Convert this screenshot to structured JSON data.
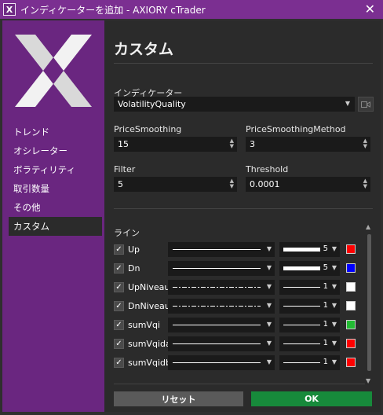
{
  "window": {
    "title": "インディケーターを追加 - AXIORY cTrader",
    "icon_glyph": "X",
    "close_glyph": "✕"
  },
  "sidebar": {
    "items": [
      {
        "label": "トレンド",
        "active": false
      },
      {
        "label": "オシレーター",
        "active": false
      },
      {
        "label": "ボラティリティ",
        "active": false
      },
      {
        "label": "取引数量",
        "active": false
      },
      {
        "label": "その他",
        "active": false
      },
      {
        "label": "カスタム",
        "active": true
      }
    ]
  },
  "main": {
    "title": "カスタム",
    "indicator": {
      "label": "インディケーター",
      "value": "VolatilityQuality"
    },
    "params": [
      {
        "label": "PriceSmoothing",
        "value": "15"
      },
      {
        "label": "PriceSmoothingMethod",
        "value": "3"
      },
      {
        "label": "Filter",
        "value": "5"
      },
      {
        "label": "Threshold",
        "value": "0.0001"
      }
    ],
    "lines_label": "ライン",
    "lines": [
      {
        "name": "Up",
        "checked": true,
        "style": "solid",
        "width": "5",
        "color": "#ff0000"
      },
      {
        "name": "Dn",
        "checked": true,
        "style": "solid",
        "width": "5",
        "color": "#0000ff"
      },
      {
        "name": "UpNiveau",
        "checked": true,
        "style": "dashdot",
        "width": "1",
        "color": "#ffffff"
      },
      {
        "name": "DnNiveau",
        "checked": true,
        "style": "dashdot",
        "width": "1",
        "color": "#ffffff"
      },
      {
        "name": "sumVqi",
        "checked": true,
        "style": "solid",
        "width": "1",
        "color": "#22bb33"
      },
      {
        "name": "sumVqida",
        "checked": true,
        "style": "solid",
        "width": "1",
        "color": "#ff0000"
      },
      {
        "name": "sumVqidb",
        "checked": true,
        "style": "solid",
        "width": "1",
        "color": "#ff0000"
      }
    ]
  },
  "buttons": {
    "reset": "リセット",
    "ok": "OK"
  }
}
